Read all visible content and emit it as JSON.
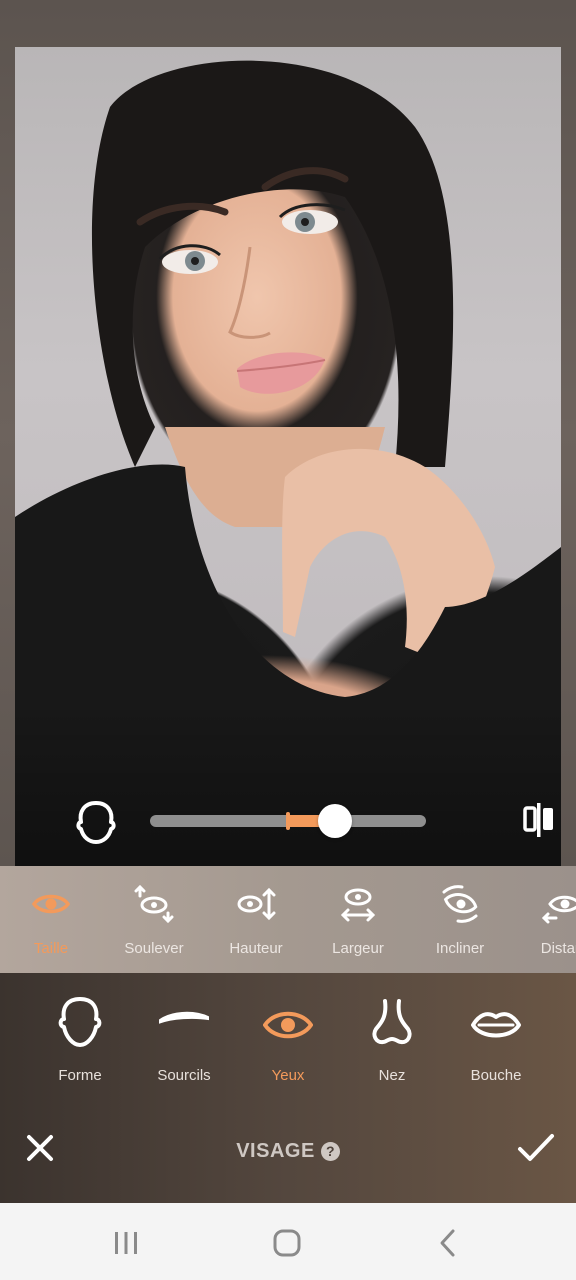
{
  "editor": {
    "slider": {
      "value_fraction": 0.67,
      "center_fraction": 0.5
    },
    "accent_color": "#f39a5b"
  },
  "sub_tools": [
    {
      "label": "Taille",
      "icon": "eye-icon",
      "active": true
    },
    {
      "label": "Soulever",
      "icon": "eye-lift-icon",
      "active": false
    },
    {
      "label": "Hauteur",
      "icon": "eye-height-icon",
      "active": false
    },
    {
      "label": "Largeur",
      "icon": "eye-width-icon",
      "active": false
    },
    {
      "label": "Incliner",
      "icon": "eye-tilt-icon",
      "active": false
    },
    {
      "label": "Distan",
      "icon": "eye-distance-icon",
      "active": false
    }
  ],
  "features": [
    {
      "label": "Forme",
      "icon": "face-shape-icon",
      "active": false
    },
    {
      "label": "Sourcils",
      "icon": "eyebrow-icon",
      "active": false
    },
    {
      "label": "Yeux",
      "icon": "eye-icon",
      "active": true
    },
    {
      "label": "Nez",
      "icon": "nose-icon",
      "active": false
    },
    {
      "label": "Bouche",
      "icon": "mouth-icon",
      "active": false
    }
  ],
  "bottom_bar": {
    "title": "VISAGE",
    "help": "?"
  },
  "system_nav": {
    "recents": "recents-icon",
    "home": "home-icon",
    "back": "back-icon"
  }
}
